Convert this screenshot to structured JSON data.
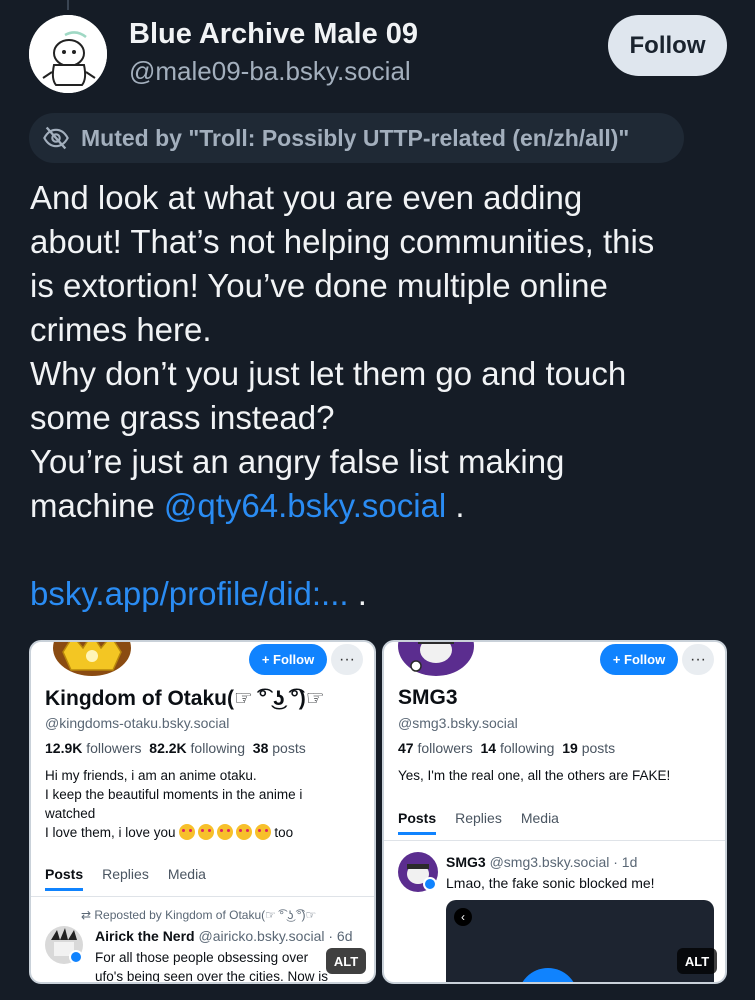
{
  "author": {
    "display_name": "Blue Archive Male 09",
    "handle": "@male09-ba.bsky.social",
    "follow_label": "Follow"
  },
  "moderation": {
    "muted_label": "Muted by \"Troll: Possibly UTTP-related (en/zh/all)\"",
    "icon": "eye-slash-icon"
  },
  "post": {
    "line1": "And look at what you are even adding",
    "line2": "about! That’s not helping communities, this",
    "line3": "is extortion! You’ve done multiple online",
    "line4": "crimes here.",
    "line5": "Why don’t you just let them go and touch",
    "line6": "some grass instead?",
    "line7": "You’re just an angry false list making",
    "line8_prefix": "machine ",
    "mention": "@qty64.bsky.social",
    "line8_suffix": " .",
    "link": "bsky.app/profile/did:...",
    "link_suffix": " ."
  },
  "images": {
    "left": {
      "follow_label": "+ Follow",
      "more_label": "···",
      "name": "Kingdom of Otaku(☞ ͡° ͜ʖ ͡°)☞",
      "handle": "@kingdoms-otaku.bsky.social",
      "followers_count": "12.9K",
      "followers_label": "followers",
      "following_count": "82.2K",
      "following_label": "following",
      "posts_count": "38",
      "posts_label": "posts",
      "bio1": "Hi my friends, i am an anime otaku.",
      "bio2": "I keep the beautiful moments in the anime i",
      "bio3": "watched",
      "bio4_prefix": "I love them, i love you ",
      "bio4_suffix": "too",
      "tabs": [
        "Posts",
        "Replies",
        "Media"
      ],
      "repost_label": "⇄ Reposted by Kingdom of Otaku(☞ ͡° ͜ʖ ͡°)☞",
      "post_author": "Airick the Nerd",
      "post_handle": "@airicko.bsky.social · 6d",
      "post_text1": "For all those people obsessing over",
      "post_text2": "ufo's being seen over the cities. Now is",
      "alt": "ALT"
    },
    "right": {
      "follow_label": "+ Follow",
      "more_label": "···",
      "name": "SMG3",
      "handle": "@smg3.bsky.social",
      "followers_count": "47",
      "followers_label": "followers",
      "following_count": "14",
      "following_label": "following",
      "posts_count": "19",
      "posts_label": "posts",
      "bio1": "Yes, I'm the real one, all the others are FAKE!",
      "tabs": [
        "Posts",
        "Replies",
        "Media"
      ],
      "post_author": "SMG3",
      "post_handle": "@smg3.bsky.social · 1d",
      "post_text1": "Lmao, the fake sonic blocked me!",
      "alt": "ALT"
    }
  },
  "colors": {
    "background": "#151c26",
    "link": "#2a8cf3",
    "follow_button": "#dfe6ee",
    "mini_follow": "#1083fe"
  }
}
